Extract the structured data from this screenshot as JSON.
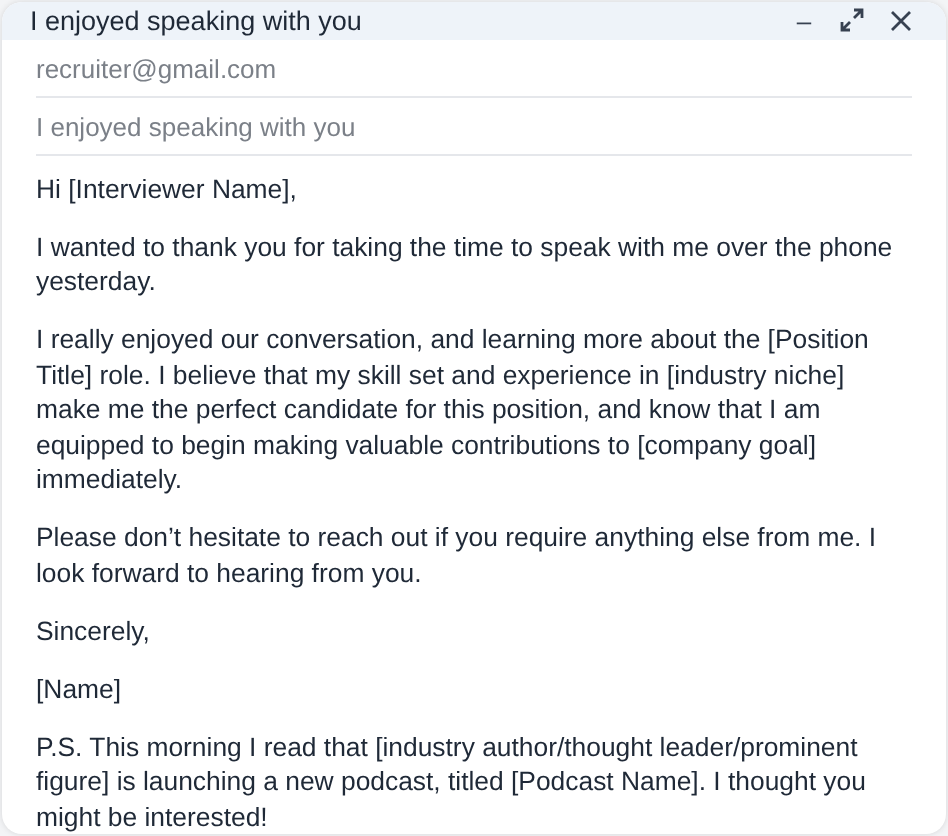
{
  "window": {
    "title": "I enjoyed speaking with you"
  },
  "controls": [
    {
      "kind": "minimize",
      "label": "–"
    },
    {
      "kind": "expand"
    },
    {
      "kind": "close"
    }
  ],
  "to": {
    "value": "recruiter@gmail.com"
  },
  "subject": {
    "value": "I enjoyed speaking with you"
  },
  "body": [
    "Hi [Interviewer Name],",
    "I wanted to thank you for taking the time to speak with me over the phone yesterday.",
    "I really enjoyed our conversation, and learning more about the [Position Title] role. I believe that my skill set and experience in [industry niche] make me the perfect candidate for this position, and know that I am equipped to begin making valuable contributions to [company goal] immediately.",
    "Please don’t hesitate to reach out if you require anything else from me. I look forward to hearing from you.",
    "Sincerely,",
    "[Name]",
    "P.S. This morning I read that [industry author/thought leader/prominent figure] is launching a new podcast, titled [Podcast Name]. I thought you might be interested!"
  ]
}
